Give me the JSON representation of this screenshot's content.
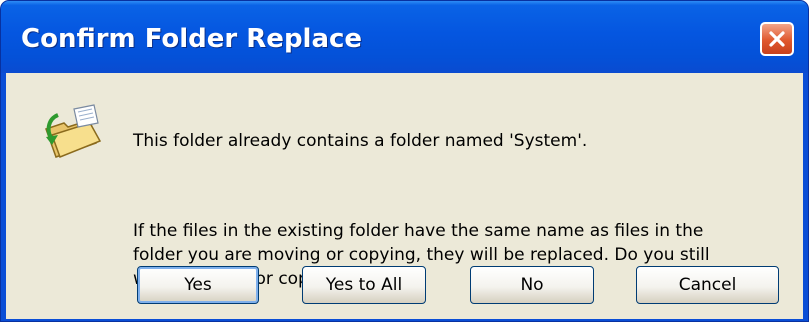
{
  "window": {
    "title": "Confirm Folder Replace",
    "close_icon": "close-icon"
  },
  "dialog": {
    "icon": "folder-move-icon",
    "message_line1": "This folder already contains a folder named 'System'.",
    "message_line2": "If the files in the existing folder have the same name as files in the folder you are moving or copying, they will be replaced.  Do you still want to move or copy the folder?"
  },
  "buttons": {
    "yes": "Yes",
    "yes_to_all": "Yes to All",
    "no": "No",
    "cancel": "Cancel"
  },
  "colors": {
    "titlebar": "#0556e0",
    "client_bg": "#ece9d8",
    "close_button": "#e0582d"
  }
}
